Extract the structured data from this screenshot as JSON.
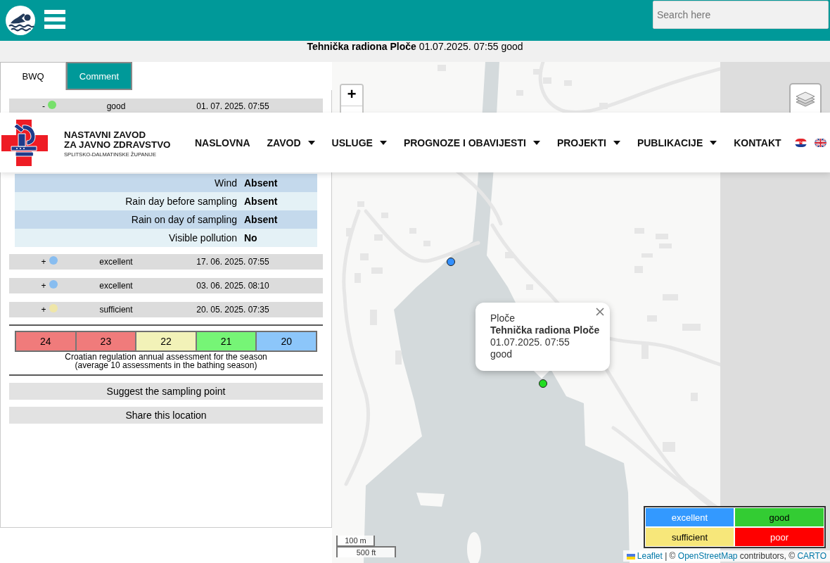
{
  "top_bar": {
    "search": {
      "placeholder": "Search here"
    }
  },
  "info_line": "**Tehnička radiona Ploče** 01.07.2025. 07:55 good",
  "tabs": [
    {
      "label": "BWQ",
      "selected": true
    },
    {
      "label": "Comment",
      "selected": false
    }
  ],
  "samples": [
    {
      "toggle": "-",
      "color": "#77e06b",
      "rating": "good",
      "date": "01. 07. 2025. 07:55",
      "details": [
        {
          "label": "Wind",
          "value": "Absent"
        },
        {
          "label": "Rain day before sampling",
          "value": "Absent"
        },
        {
          "label": "Rain on day of sampling",
          "value": "Absent"
        },
        {
          "label": "Visible pollution",
          "value": "No"
        }
      ]
    },
    {
      "toggle": "+",
      "color": "#88bdf0",
      "rating": "excellent",
      "date": "17. 06. 2025. 07:55"
    },
    {
      "toggle": "+",
      "color": "#88bdf0",
      "rating": "excellent",
      "date": "03. 06. 2025. 08:10"
    },
    {
      "toggle": "+",
      "color": "#efe6a8",
      "rating": "sufficient",
      "date": "20. 05. 2025. 07:35"
    }
  ],
  "assessment": {
    "cells": [
      {
        "value": "24",
        "color": "#f07b7b"
      },
      {
        "value": "23",
        "color": "#f07b7b"
      },
      {
        "value": "22",
        "color": "#f2f2b8"
      },
      {
        "value": "21",
        "color": "#76f576"
      },
      {
        "value": "20",
        "color": "#8cc6fa"
      }
    ],
    "caption": [
      "Croatian regulation annual assessment for the season",
      "(average 10 assessments in the bathing season)"
    ]
  },
  "actions": [
    "Suggest the sampling point",
    "Share this location"
  ],
  "header": {
    "title_lines": [
      "NASTAVNI ZAVOD",
      "ZA JAVNO ZDRAVSTVO"
    ],
    "subtitle": "SPLITSKO-DALMATINSKE ŽUPANIJE",
    "nav": [
      {
        "label": "NASLOVNA",
        "dropdown": false
      },
      {
        "label": "ZAVOD",
        "dropdown": true
      },
      {
        "label": "USLUGE",
        "dropdown": true
      },
      {
        "label": "PROGNOZE I OBAVIJESTI",
        "dropdown": true
      },
      {
        "label": "PROJEKTI",
        "dropdown": true
      },
      {
        "label": "PUBLIKACIJE",
        "dropdown": true
      },
      {
        "label": "KONTAKT",
        "dropdown": false
      }
    ]
  },
  "map": {
    "zoom_in": "+",
    "markers": [
      {
        "color": "#3390ff"
      },
      {
        "color": "#22dd22"
      }
    ],
    "popup": {
      "place": "Ploče",
      "title": "Tehnička radiona Ploče",
      "datetime": "01.07.2025. 07:55",
      "rating": "good"
    },
    "legend": [
      {
        "label": "excellent",
        "color": "#3399ff"
      },
      {
        "label": "good",
        "color": "#33cc33"
      },
      {
        "label": "sufficient",
        "color": "#f7e77a"
      },
      {
        "label": "poor",
        "color": "#ff0000"
      }
    ],
    "scale": [
      "100 m",
      "500 ft"
    ],
    "attribution": [
      {
        "kind": "link",
        "text": "Leaflet"
      },
      {
        "kind": "text",
        "text": "| ©"
      },
      {
        "kind": "link",
        "text": "OpenStreetMap"
      },
      {
        "kind": "text",
        "text": "contributors, ©"
      },
      {
        "kind": "link",
        "text": "CARTO"
      }
    ]
  }
}
